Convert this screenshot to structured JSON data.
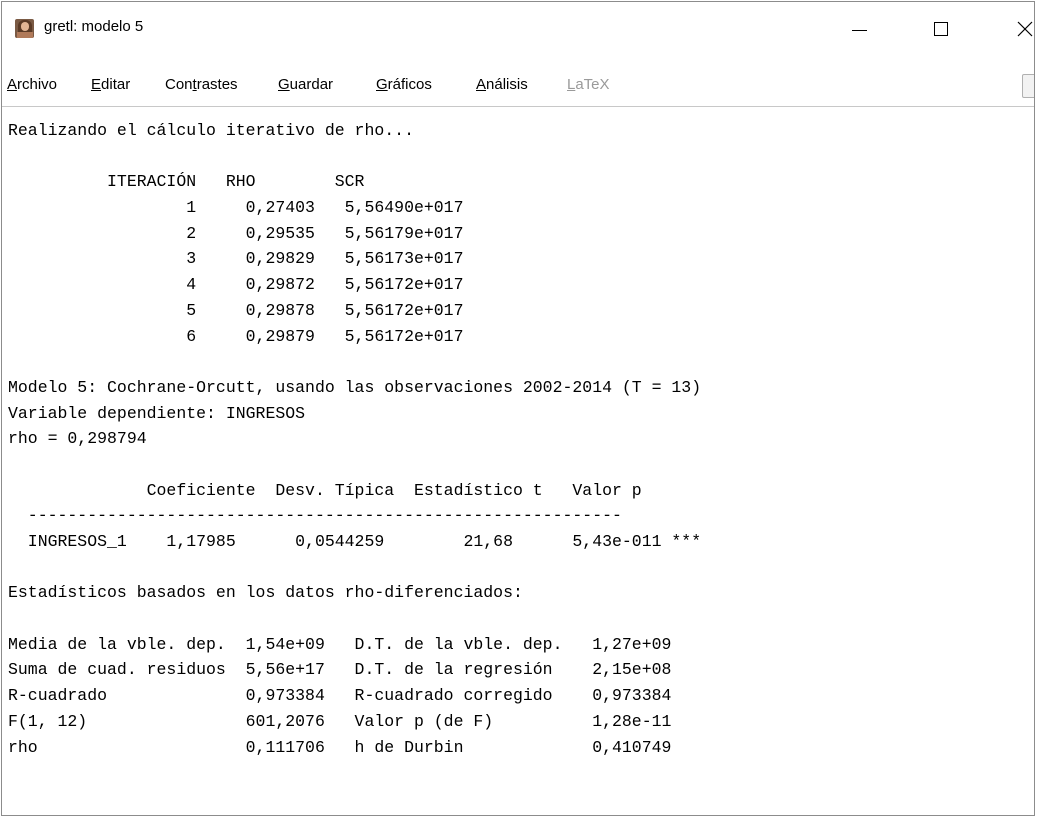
{
  "window": {
    "title": "gretl: modelo 5",
    "controls": {
      "minimize": "minimize",
      "maximize": "maximize",
      "close": "close"
    }
  },
  "menubar": {
    "items": [
      {
        "pre": "",
        "key": "A",
        "post": "rchivo",
        "enabled": true
      },
      {
        "pre": "",
        "key": "E",
        "post": "ditar",
        "enabled": true
      },
      {
        "pre": "Con",
        "key": "t",
        "post": "rastes",
        "enabled": true
      },
      {
        "pre": "",
        "key": "G",
        "post": "uardar",
        "enabled": true
      },
      {
        "pre": "",
        "key": "G",
        "post": "ráficos",
        "enabled": true
      },
      {
        "pre": "",
        "key": "A",
        "post": "nálisis",
        "enabled": true
      },
      {
        "pre": "",
        "key": "L",
        "post": "aTeX",
        "enabled": false
      }
    ]
  },
  "output": {
    "lines": [
      "Realizando el cálculo iterativo de rho...",
      "",
      "          ITERACIÓN   RHO        SCR",
      "                  1     0,27403   5,56490e+017",
      "                  2     0,29535   5,56179e+017",
      "                  3     0,29829   5,56173e+017",
      "                  4     0,29872   5,56172e+017",
      "                  5     0,29878   5,56172e+017",
      "                  6     0,29879   5,56172e+017",
      "",
      "Modelo 5: Cochrane-Orcutt, usando las observaciones 2002-2014 (T = 13)",
      "Variable dependiente: INGRESOS",
      "rho = 0,298794",
      "",
      "              Coeficiente  Desv. Típica  Estadístico t   Valor p",
      "  ------------------------------------------------------------",
      "  INGRESOS_1    1,17985      0,0544259        21,68      5,43e-011 ***",
      "",
      "Estadísticos basados en los datos rho-diferenciados:",
      "",
      "Media de la vble. dep.  1,54e+09   D.T. de la vble. dep.   1,27e+09",
      "Suma de cuad. residuos  5,56e+17   D.T. de la regresión    2,15e+08",
      "R-cuadrado              0,973384   R-cuadrado corregido    0,973384",
      "F(1, 12)                601,2076   Valor p (de F)          1,28e-11",
      "rho                     0,111706   h de Durbin             0,410749"
    ]
  }
}
